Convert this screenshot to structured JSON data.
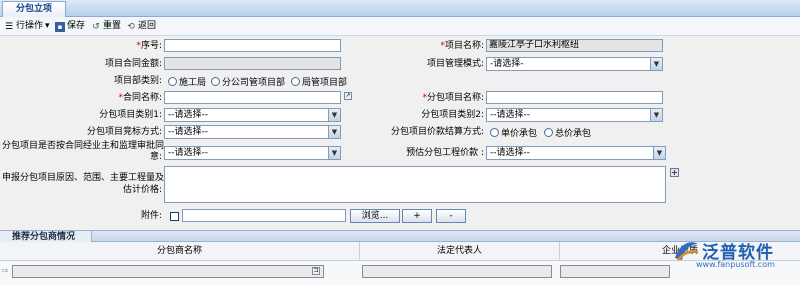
{
  "tab": "分包立项",
  "toolbar": {
    "row_ops": "行操作",
    "row_ops_arrow": "▾",
    "save": "保存",
    "reset": "重置",
    "back": "返回"
  },
  "form": {
    "seq_label": "序号:",
    "seq_value": "",
    "project_name_label": "项目名称:",
    "project_name_value": "嘉陵江亭子口水利枢纽",
    "contract_amount_label": "项目合同金额:",
    "contract_amount_value": "",
    "mgmt_mode_label": "项目管理模式:",
    "mgmt_mode_value": "-请选择-",
    "dept_type_label": "项目部类别:",
    "dept_options": [
      "施工局",
      "分公司管项目部",
      "局管项目部"
    ],
    "contract_name_label": "合同名称:",
    "contract_name_value": "",
    "sub_project_name_label": "分包项目名称:",
    "sub_project_name_value": "",
    "sub_cat1_label": "分包项目类别1:",
    "sub_cat1_value": "--请选择--",
    "sub_cat2_label": "分包项目类别2:",
    "sub_cat2_value": "--请选择--",
    "bid_mode_label": "分包项目竞标方式:",
    "bid_mode_value": "--请选择--",
    "price_settle_label": "分包项目价款结算方式:",
    "price_options": [
      "单价承包",
      "总价承包"
    ],
    "approval_label_1": "分包项目是否按合同经业主和监理审批同",
    "approval_label_2": "意:",
    "approval_value": "--请选择--",
    "estimate_label": "预估分包工程价款 :",
    "estimate_value": "--请选择--",
    "reason_label_1": "申报分包项目原因、范围、主要工程量及",
    "reason_label_2": "估计价格:",
    "attachment_label": "附件:",
    "browse_label": "浏览...",
    "add_label": "+",
    "remove_label": "-"
  },
  "section": {
    "title": "推荐分包商情况"
  },
  "grid": {
    "columns": [
      "分包商名称",
      "法定代表人",
      "企业资质"
    ]
  },
  "logo": {
    "name": "泛普软件",
    "url": "www.fanpusoft.com"
  },
  "colors": {
    "required": "#dd0000",
    "header_bg": "#dce9f7",
    "logo_blue": "#1f5fb0"
  }
}
